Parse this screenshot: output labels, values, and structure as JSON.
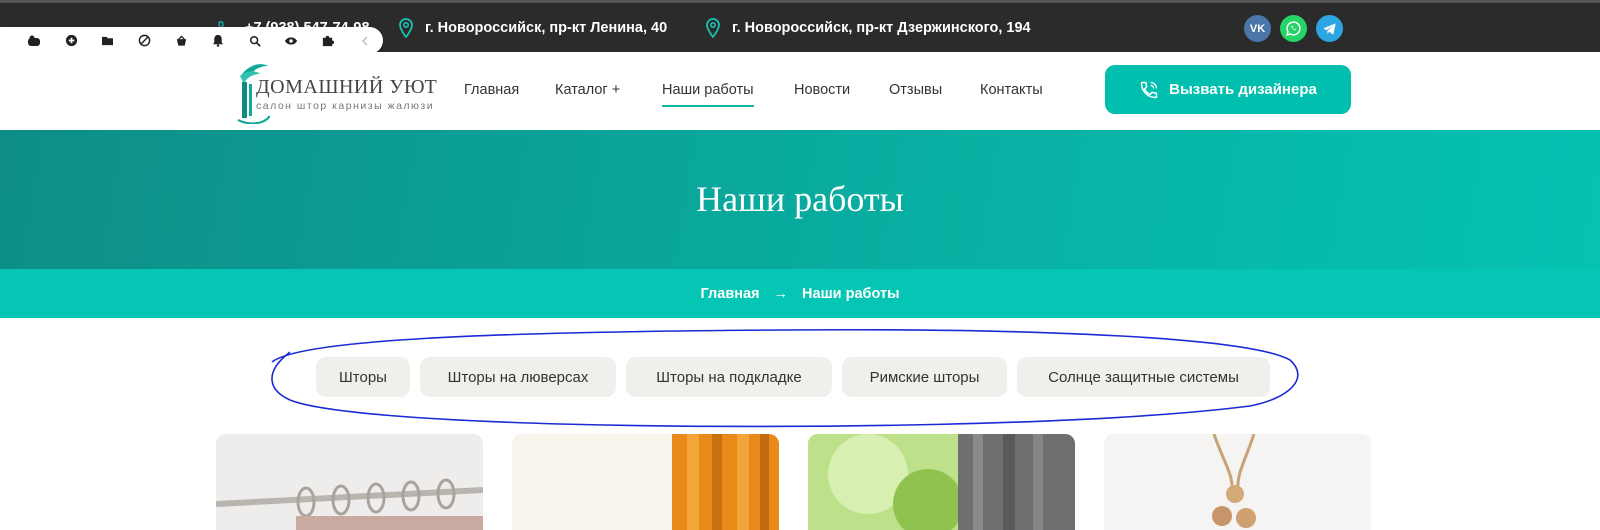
{
  "topbar": {
    "phone": "+7 (938) 547-74-98",
    "address_1": "г. Новороссийск, пр-кт Ленина, 40",
    "address_2": "г. Новороссийск, пр-кт Дзержинского, 194",
    "social": [
      {
        "icon": "vk-icon",
        "label": "VK",
        "color": "#4a76a8"
      },
      {
        "icon": "whatsapp-icon",
        "color": "#25d366"
      },
      {
        "icon": "telegram-icon",
        "color": "#2ca5e0"
      }
    ]
  },
  "extension_toolbar": {
    "icons": [
      "vbucket-icon",
      "plus-circle-icon",
      "folder-icon",
      "block-icon",
      "basket-icon",
      "bell-icon",
      "search-icon",
      "eye-icon",
      "puzzle-icon",
      "chevron-left-icon"
    ]
  },
  "logo": {
    "title": "ДОМАШНИЙ УЮТ",
    "subtitle": "салон штор  карнизы  жалюзи"
  },
  "nav": {
    "items": [
      {
        "label": "Главная"
      },
      {
        "label": "Каталог  +"
      },
      {
        "label": "Наши работы",
        "active": true
      },
      {
        "label": "Новости"
      },
      {
        "label": "Отзывы"
      },
      {
        "label": "Контакты"
      }
    ]
  },
  "cta": {
    "label": "Вызвать дизайнера",
    "icon": "phone-call-icon"
  },
  "hero": {
    "title": "Наши работы"
  },
  "breadcrumb": {
    "home": "Главная",
    "separator": "→",
    "current": "Наши работы"
  },
  "filters": {
    "items": [
      {
        "label": "Шторы"
      },
      {
        "label": "Шторы на люверсах"
      },
      {
        "label": "Шторы на подкладке"
      },
      {
        "label": "Римские шторы"
      },
      {
        "label": "Солнце защитные системы"
      }
    ]
  },
  "colors": {
    "accent": "#00bfae",
    "topbar": "#2b2b2b",
    "filter_bg": "#f1efec",
    "annotation": "#1a2ad4"
  }
}
